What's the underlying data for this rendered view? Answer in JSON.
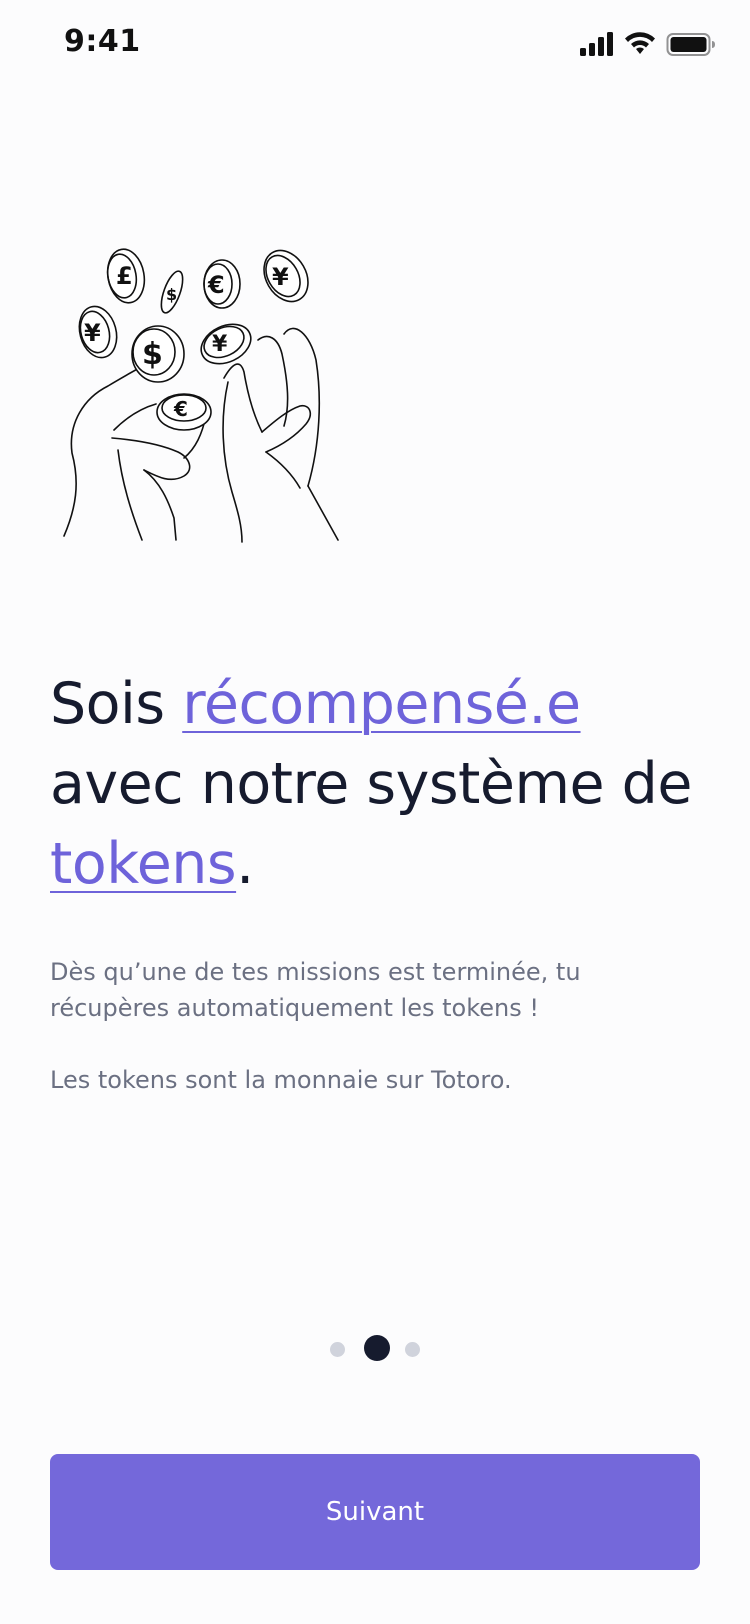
{
  "status_bar": {
    "time": "9:41",
    "icons": [
      "signal-icon",
      "wifi-icon",
      "battery-icon"
    ]
  },
  "illustration": {
    "icon": "hands-tossing-coins-icon",
    "coin_symbols": [
      "£",
      "€",
      "¥",
      "¥",
      "$",
      "¥",
      "€"
    ]
  },
  "headline": {
    "part1": "Sois ",
    "highlight1": "récompensé.e",
    "part2": " avec notre système de ",
    "highlight2": "tokens",
    "part3": "."
  },
  "description": {
    "line1": "Dès qu’une de tes missions est terminée, tu récupères automatiquement les tokens !",
    "line2": "Les tokens sont la monnaie sur Totoro."
  },
  "pagination": {
    "total": 3,
    "active_index": 2
  },
  "button": {
    "label": "Suivant"
  },
  "colors": {
    "accent": "#7468DA",
    "highlight_text": "#6E63DA",
    "heading": "#161B2E",
    "body_text": "#6B7082",
    "dot_inactive": "#D0D3DC",
    "background": "#FCFCFD"
  }
}
